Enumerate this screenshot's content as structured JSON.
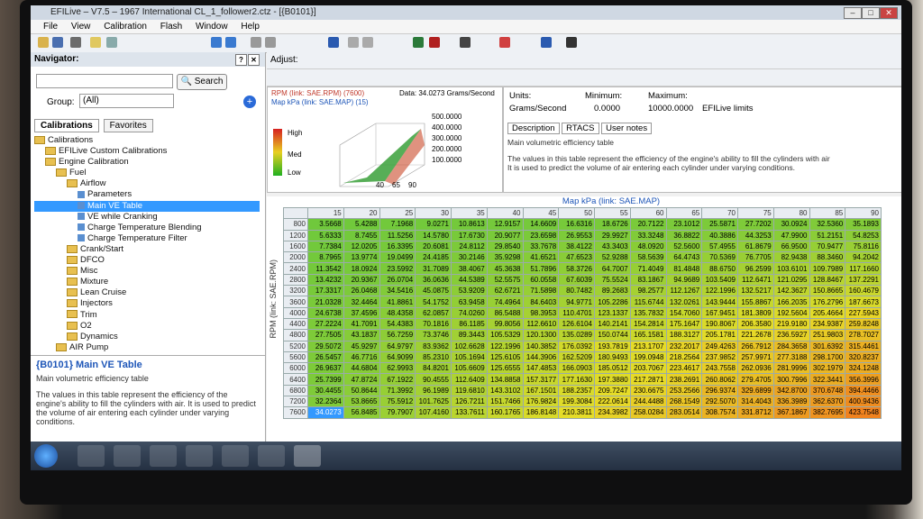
{
  "window": {
    "title": "EFILive – V7.5 – 1967 International CL_1_follower2.ctz - [{B0101}]"
  },
  "menu": [
    "File",
    "View",
    "Calibration",
    "Flash",
    "Window",
    "Help"
  ],
  "navigator": {
    "title": "Navigator:",
    "search_label": "Search",
    "group_label": "Group:",
    "group_value": "(All)",
    "tab_calibrations": "Calibrations",
    "tab_favorites": "Favorites",
    "tree": [
      {
        "label": "Calibrations",
        "level": 0,
        "kind": "folder"
      },
      {
        "label": "EFILive Custom Calibrations",
        "level": 1,
        "kind": "folder"
      },
      {
        "label": "Engine Calibration",
        "level": 1,
        "kind": "folder"
      },
      {
        "label": "Fuel",
        "level": 2,
        "kind": "folder"
      },
      {
        "label": "Airflow",
        "level": 3,
        "kind": "folder"
      },
      {
        "label": "Parameters",
        "level": 4,
        "kind": "leaf"
      },
      {
        "label": "Main VE Table",
        "level": 4,
        "kind": "leaf"
      },
      {
        "label": "VE while Cranking",
        "level": 4,
        "kind": "leaf"
      },
      {
        "label": "Charge Temperature Blending",
        "level": 4,
        "kind": "leaf"
      },
      {
        "label": "Charge Temperature Filter",
        "level": 4,
        "kind": "leaf"
      },
      {
        "label": "Crank/Start",
        "level": 3,
        "kind": "folder"
      },
      {
        "label": "DFCO",
        "level": 3,
        "kind": "folder"
      },
      {
        "label": "Misc",
        "level": 3,
        "kind": "folder"
      },
      {
        "label": "Mixture",
        "level": 3,
        "kind": "folder"
      },
      {
        "label": "Lean Cruise",
        "level": 3,
        "kind": "folder"
      },
      {
        "label": "Injectors",
        "level": 3,
        "kind": "folder"
      },
      {
        "label": "Trim",
        "level": 3,
        "kind": "folder"
      },
      {
        "label": "O2",
        "level": 3,
        "kind": "folder"
      },
      {
        "label": "Dynamics",
        "level": 3,
        "kind": "folder"
      },
      {
        "label": "AIR Pump",
        "level": 2,
        "kind": "folder"
      }
    ],
    "info_title": "{B0101} Main VE Table",
    "info_sub": "Main volumetric efficiency table",
    "info_text": "The values in this table represent the efficiency of the engine's ability to fill the cylinders with air. It is used to predict the volume of air entering each cylinder under varying conditions."
  },
  "adjust_label": "Adjust:",
  "graph": {
    "rpm_label": "RPM (link: SAE.RPM) (7600)",
    "map_label": "Map kPa (link: SAE.MAP) (15)",
    "data_label": "Data: 34.0273 Grams/Second",
    "legend": [
      "High",
      "Med",
      "Low"
    ],
    "z_ticks": [
      "500.0000",
      "400.0000",
      "300.0000",
      "200.0000",
      "100.0000"
    ],
    "x_ticks": [
      "40",
      "65",
      "90"
    ]
  },
  "props": {
    "units_label": "Units:",
    "units_value": "Grams/Second",
    "min_label": "Minimum:",
    "min_value": "0.0000",
    "max_label": "Maximum:",
    "max_value": "10000.0000",
    "limits": "EFILive limits",
    "tabs": [
      "Description",
      "RTACS",
      "User notes"
    ],
    "desc_line1": "Main volumetric efficiency table",
    "desc_line2": "The values in this table represent the efficiency of the engine's ability to fill the cylinders with air",
    "desc_line3": "It is used to predict the volume of air entering each cylinder under varying conditions."
  },
  "table": {
    "col_header": "Map kPa (link: SAE.MAP)",
    "row_header": "RPM (link: SAE.RPM)",
    "cols": [
      "15",
      "20",
      "25",
      "30",
      "35",
      "40",
      "45",
      "50",
      "55",
      "60",
      "65",
      "70",
      "75",
      "80",
      "85",
      "90"
    ],
    "rows": [
      {
        "rpm": "800",
        "v": [
          "3.5668",
          "5.4288",
          "7.1968",
          "9.0271",
          "10.8613",
          "12.9157",
          "14.6609",
          "16.6316",
          "18.6726",
          "20.7122",
          "23.1012",
          "25.5871",
          "27.7202",
          "30.0924",
          "32.5360",
          "35.1893"
        ]
      },
      {
        "rpm": "1200",
        "v": [
          "5.6333",
          "8.7455",
          "11.5256",
          "14.5780",
          "17.6730",
          "20.9077",
          "23.6598",
          "26.9553",
          "29.9927",
          "33.3248",
          "36.8822",
          "40.3886",
          "44.3253",
          "47.9900",
          "51.2151",
          "54.8253"
        ]
      },
      {
        "rpm": "1600",
        "v": [
          "7.7384",
          "12.0205",
          "16.3395",
          "20.6081",
          "24.8112",
          "29.8540",
          "33.7678",
          "38.4122",
          "43.3403",
          "48.0920",
          "52.5600",
          "57.4955",
          "61.8679",
          "66.9500",
          "70.9477",
          "75.8116"
        ]
      },
      {
        "rpm": "2000",
        "v": [
          "8.7965",
          "13.9774",
          "19.0499",
          "24.4185",
          "30.2146",
          "35.9298",
          "41.6521",
          "47.6523",
          "52.9288",
          "58.5639",
          "64.4743",
          "70.5369",
          "76.7705",
          "82.9438",
          "88.3460",
          "94.2042"
        ]
      },
      {
        "rpm": "2400",
        "v": [
          "11.3542",
          "18.0924",
          "23.5992",
          "31.7089",
          "38.4067",
          "45.3638",
          "51.7896",
          "58.3726",
          "64.7007",
          "71.4049",
          "81.4848",
          "88.6750",
          "96.2599",
          "103.6101",
          "109.7989",
          "117.1660"
        ]
      },
      {
        "rpm": "2800",
        "v": [
          "13.4232",
          "20.9367",
          "26.0704",
          "36.0636",
          "44.5389",
          "52.5575",
          "60.0558",
          "67.6039",
          "75.5524",
          "83.1867",
          "94.9689",
          "103.5409",
          "112.6471",
          "121.0295",
          "128.8467",
          "137.2291"
        ]
      },
      {
        "rpm": "3200",
        "v": [
          "17.3317",
          "26.0468",
          "34.5416",
          "45.0875",
          "53.9209",
          "62.6721",
          "71.5898",
          "80.7482",
          "89.2683",
          "98.2577",
          "112.1267",
          "122.1996",
          "132.5217",
          "142.3627",
          "150.8665",
          "160.4679"
        ]
      },
      {
        "rpm": "3600",
        "v": [
          "21.0328",
          "32.4464",
          "41.8861",
          "54.1752",
          "63.9458",
          "74.4964",
          "84.6403",
          "94.9771",
          "105.2286",
          "115.6744",
          "132.0261",
          "143.9444",
          "155.8867",
          "166.2035",
          "176.2796",
          "187.6673"
        ]
      },
      {
        "rpm": "4000",
        "v": [
          "24.6738",
          "37.4596",
          "48.4358",
          "62.0857",
          "74.0260",
          "86.5488",
          "98.3953",
          "110.4701",
          "123.1337",
          "135.7832",
          "154.7060",
          "167.9451",
          "181.3809",
          "192.5604",
          "205.4664",
          "227.5943"
        ]
      },
      {
        "rpm": "4400",
        "v": [
          "27.2224",
          "41.7091",
          "54.4383",
          "70.1816",
          "86.1185",
          "99.8056",
          "112.6610",
          "126.6104",
          "140.2141",
          "154.2814",
          "175.1647",
          "190.8067",
          "206.3580",
          "219.9180",
          "234.9387",
          "259.8248"
        ]
      },
      {
        "rpm": "4800",
        "v": [
          "27.7505",
          "43.1837",
          "56.7259",
          "73.3746",
          "89.3443",
          "105.5329",
          "120.1300",
          "135.0289",
          "150.0744",
          "165.1581",
          "188.3127",
          "205.1781",
          "221.2678",
          "236.5927",
          "251.9803",
          "278.7027"
        ]
      },
      {
        "rpm": "5200",
        "v": [
          "29.5072",
          "45.9297",
          "64.9797",
          "83.9362",
          "102.6628",
          "122.1996",
          "140.3852",
          "176.0392",
          "193.7819",
          "213.1707",
          "232.2017",
          "249.4263",
          "266.7912",
          "284.3658",
          "301.6392",
          "315.4461"
        ]
      },
      {
        "rpm": "5600",
        "v": [
          "26.5457",
          "46.7716",
          "64.9099",
          "85.2310",
          "105.1694",
          "125.6105",
          "144.3906",
          "162.5209",
          "180.9493",
          "199.0948",
          "218.2564",
          "237.9852",
          "257.9971",
          "277.3188",
          "298.1700",
          "320.8237"
        ]
      },
      {
        "rpm": "6000",
        "v": [
          "26.9637",
          "44.6804",
          "62.9993",
          "84.8201",
          "105.6609",
          "125.6555",
          "147.4853",
          "166.0903",
          "185.0512",
          "203.7067",
          "223.4617",
          "243.7558",
          "262.0936",
          "281.9996",
          "302.1979",
          "324.1248"
        ]
      },
      {
        "rpm": "6400",
        "v": [
          "25.7399",
          "47.8724",
          "67.1922",
          "90.4555",
          "112.6409",
          "134.8858",
          "157.3177",
          "177.1630",
          "197.3880",
          "217.2871",
          "238.2691",
          "260.8062",
          "279.4705",
          "300.7996",
          "322.3441",
          "356.3996"
        ]
      },
      {
        "rpm": "6800",
        "v": [
          "30.4455",
          "50.8644",
          "71.3992",
          "96.1989",
          "119.6810",
          "143.3102",
          "167.1501",
          "188.2357",
          "209.7247",
          "230.6675",
          "253.2566",
          "296.9374",
          "329.6899",
          "342.8700",
          "370.6748",
          "394.4466"
        ]
      },
      {
        "rpm": "7200",
        "v": [
          "32.2364",
          "53.8665",
          "75.5912",
          "101.7625",
          "126.7211",
          "151.7466",
          "176.9824",
          "199.3084",
          "222.0614",
          "244.4488",
          "268.1549",
          "292.5070",
          "314.4043",
          "336.3989",
          "362.6370",
          "400.9436"
        ]
      },
      {
        "rpm": "7600",
        "v": [
          "34.0273",
          "56.8485",
          "79.7907",
          "107.4160",
          "133.7611",
          "160.1765",
          "186.8148",
          "210.3811",
          "234.3982",
          "258.0284",
          "283.0514",
          "308.7574",
          "331.8712",
          "367.1867",
          "382.7695",
          "423.7548"
        ]
      }
    ]
  }
}
